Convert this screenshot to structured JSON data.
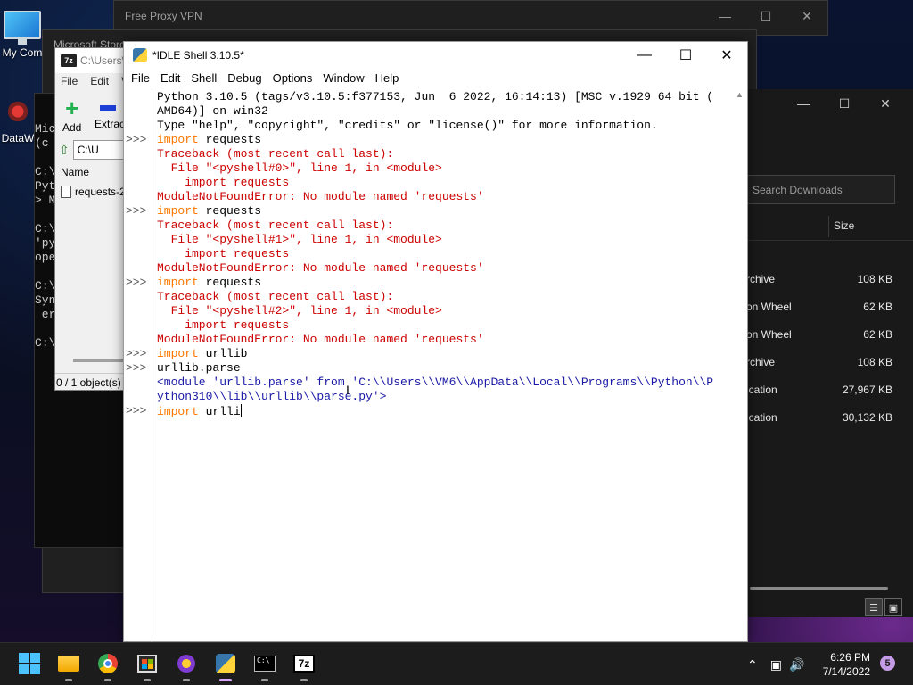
{
  "desktop": {
    "icons": [
      {
        "label": "My Com"
      },
      {
        "label": "DataW"
      }
    ]
  },
  "vpn_window": {
    "title": "Free Proxy VPN"
  },
  "store_window": {
    "title": "Microsoft Store"
  },
  "downloads_window": {
    "search_placeholder": "Search Downloads",
    "size_header": "Size",
    "rows": [
      {
        "type": "rchive",
        "size": "108 KB"
      },
      {
        "type": "on Wheel",
        "size": "62 KB"
      },
      {
        "type": "on Wheel",
        "size": "62 KB"
      },
      {
        "type": "rchive",
        "size": "108 KB"
      },
      {
        "type": "ication",
        "size": "27,967 KB"
      },
      {
        "type": "ication",
        "size": "30,132 KB"
      }
    ]
  },
  "cmd_window": {
    "lines": [
      "Mic",
      "(c",
      "",
      "C:\\",
      "Pyt",
      "> M",
      "",
      "C:\\",
      "'py",
      "ope",
      "",
      "C:\\",
      "Syn",
      " er",
      "",
      "C:\\"
    ]
  },
  "sevenzip_window": {
    "title": "C:\\Users\\",
    "menu": [
      "File",
      "Edit",
      "V"
    ],
    "add_label": "Add",
    "extract_label": "Extrac",
    "address": "C:\\U",
    "name_header": "Name",
    "file_name": "requests-2",
    "status": "0 / 1 object(s)"
  },
  "idle_window": {
    "title": "*IDLE Shell 3.10.5*",
    "menu": [
      "File",
      "Edit",
      "Shell",
      "Debug",
      "Options",
      "Window",
      "Help"
    ],
    "lines": [
      {
        "text": "Python 3.10.5 (tags/v3.10.5:f377153, Jun  6 2022, 16:14:13) [MSC v.1929 64 bit (",
        "kind": "plain",
        "prompt": ""
      },
      {
        "text": "AMD64)] on win32",
        "kind": "plain",
        "prompt": ""
      },
      {
        "text": "Type \"help\", \"copyright\", \"credits\" or \"license()\" for more information.",
        "kind": "plain",
        "prompt": ""
      },
      {
        "text": "import requests",
        "kind": "input",
        "prompt": ">>>",
        "keyword": "import",
        "rest": " requests"
      },
      {
        "text": "Traceback (most recent call last):",
        "kind": "err",
        "prompt": ""
      },
      {
        "text": "  File \"<pyshell#0>\", line 1, in <module>",
        "kind": "err",
        "prompt": ""
      },
      {
        "text": "    import requests",
        "kind": "err",
        "prompt": ""
      },
      {
        "text": "ModuleNotFoundError: No module named 'requests'",
        "kind": "err",
        "prompt": ""
      },
      {
        "text": "import requests",
        "kind": "input",
        "prompt": ">>>",
        "keyword": "import",
        "rest": " requests"
      },
      {
        "text": "Traceback (most recent call last):",
        "kind": "err",
        "prompt": ""
      },
      {
        "text": "  File \"<pyshell#1>\", line 1, in <module>",
        "kind": "err",
        "prompt": ""
      },
      {
        "text": "    import requests",
        "kind": "err",
        "prompt": ""
      },
      {
        "text": "ModuleNotFoundError: No module named 'requests'",
        "kind": "err",
        "prompt": ""
      },
      {
        "text": "import requests",
        "kind": "input",
        "prompt": ">>>",
        "keyword": "import",
        "rest": " requests"
      },
      {
        "text": "Traceback (most recent call last):",
        "kind": "err",
        "prompt": ""
      },
      {
        "text": "  File \"<pyshell#2>\", line 1, in <module>",
        "kind": "err",
        "prompt": ""
      },
      {
        "text": "    import requests",
        "kind": "err",
        "prompt": ""
      },
      {
        "text": "ModuleNotFoundError: No module named 'requests'",
        "kind": "err",
        "prompt": ""
      },
      {
        "text": "import urllib",
        "kind": "input",
        "prompt": ">>>",
        "keyword": "import",
        "rest": " urllib"
      },
      {
        "text": "urllib.parse",
        "kind": "plain",
        "prompt": ">>>"
      },
      {
        "text": "<module 'urllib.parse' from 'C:\\\\Users\\\\VM6\\\\AppData\\\\Local\\\\Programs\\\\Python\\\\P",
        "kind": "out",
        "prompt": ""
      },
      {
        "text": "ython310\\\\lib\\\\urllib\\\\parse.py'>",
        "kind": "out",
        "prompt": ""
      },
      {
        "text": "import urlli",
        "kind": "input",
        "prompt": ">>>",
        "keyword": "import",
        "rest": " urlli",
        "cursor": true
      }
    ]
  },
  "taskbar": {
    "time": "6:26 PM",
    "date": "7/14/2022",
    "notification_count": "5"
  },
  "colors": {
    "idle_keyword": "#ff7700",
    "idle_error": "#cc0000",
    "idle_output": "#1a1aa6",
    "taskbar_bg": "#1c1c1c",
    "accent": "#4cc2ff"
  }
}
